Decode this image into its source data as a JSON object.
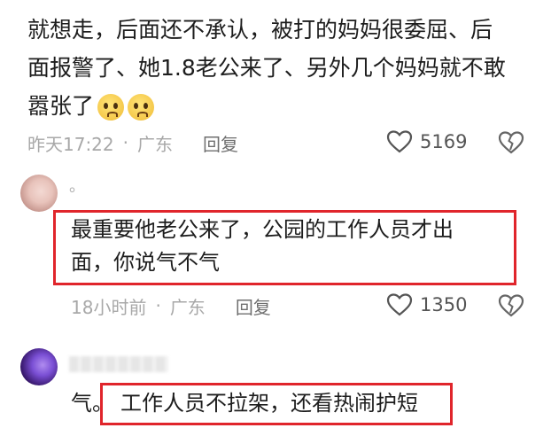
{
  "comment1": {
    "text_line1": "就想走，后面还不承认，被打的妈妈很委屈、后",
    "text_line2": "面报警了、她1.8老公来了、另外几个妈妈就不敢",
    "text_line3": "嚣张了",
    "emojis": [
      "pleading-face",
      "pleading-face"
    ],
    "time": "昨天17:22",
    "separator": "·",
    "location": "广东",
    "reply_label": "回复",
    "like_count": "5169"
  },
  "reply1": {
    "username": "。",
    "text_line1": "最重要他老公来了，公园的工作人员才出",
    "text_line2": "面，你说气不气",
    "time": "18小时前",
    "separator": "·",
    "location": "广东",
    "reply_label": "回复",
    "like_count": "1350"
  },
  "reply2": {
    "text_prefix": "气。",
    "text_highlight": "工作人员不拉架，还看热闹护短"
  },
  "colors": {
    "highlight_border": "#e0252b",
    "meta_text": "#a8a8a8"
  }
}
